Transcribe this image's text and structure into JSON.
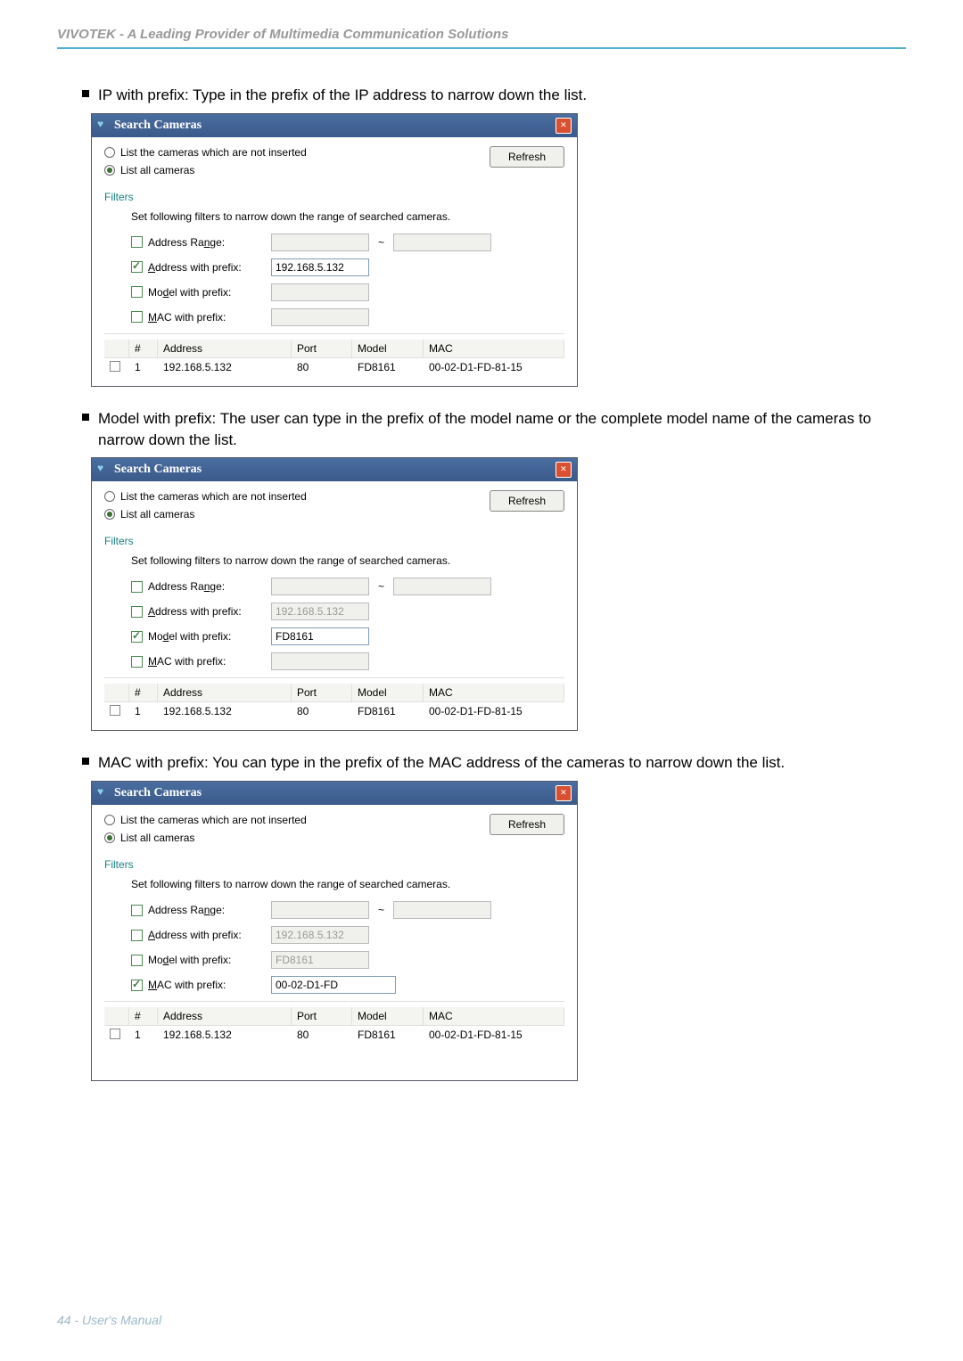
{
  "header": "VIVOTEK - A Leading Provider of Multimedia Communication Solutions",
  "footer": "44 - User's Manual",
  "sections": [
    {
      "text": "IP with prefix: Type in the prefix of the IP address to narrow down the list."
    },
    {
      "text": "Model with prefix: The user can type in the prefix of the model name or the complete model name of the cameras to narrow down the list."
    },
    {
      "text": "MAC with prefix: You can type in the prefix of the MAC address of the cameras to narrow down the list."
    }
  ],
  "dialog": {
    "title": "Search Cameras",
    "radio_not_inserted": "List the cameras which are not inserted",
    "radio_all": "List all cameras",
    "refresh": "Refresh",
    "filters_label": "Filters",
    "filters_desc": "Set following filters to narrow down the range of searched cameras.",
    "addr_range_label": "Address Range:",
    "addr_prefix_label": "Address with prefix:",
    "model_prefix_label": "Model with prefix:",
    "mac_prefix_label": "MAC with prefix:",
    "addr_prefix_value": "192.168.5.132",
    "model_prefix_value": "FD8161",
    "mac_prefix_value": "00-02-D1-FD",
    "table": {
      "h_num": "#",
      "h_addr": "Address",
      "h_port": "Port",
      "h_model": "Model",
      "h_mac": "MAC",
      "row": {
        "num": "1",
        "addr": "192.168.5.132",
        "port": "80",
        "model": "FD8161",
        "mac": "00-02-D1-FD-81-15"
      }
    }
  }
}
